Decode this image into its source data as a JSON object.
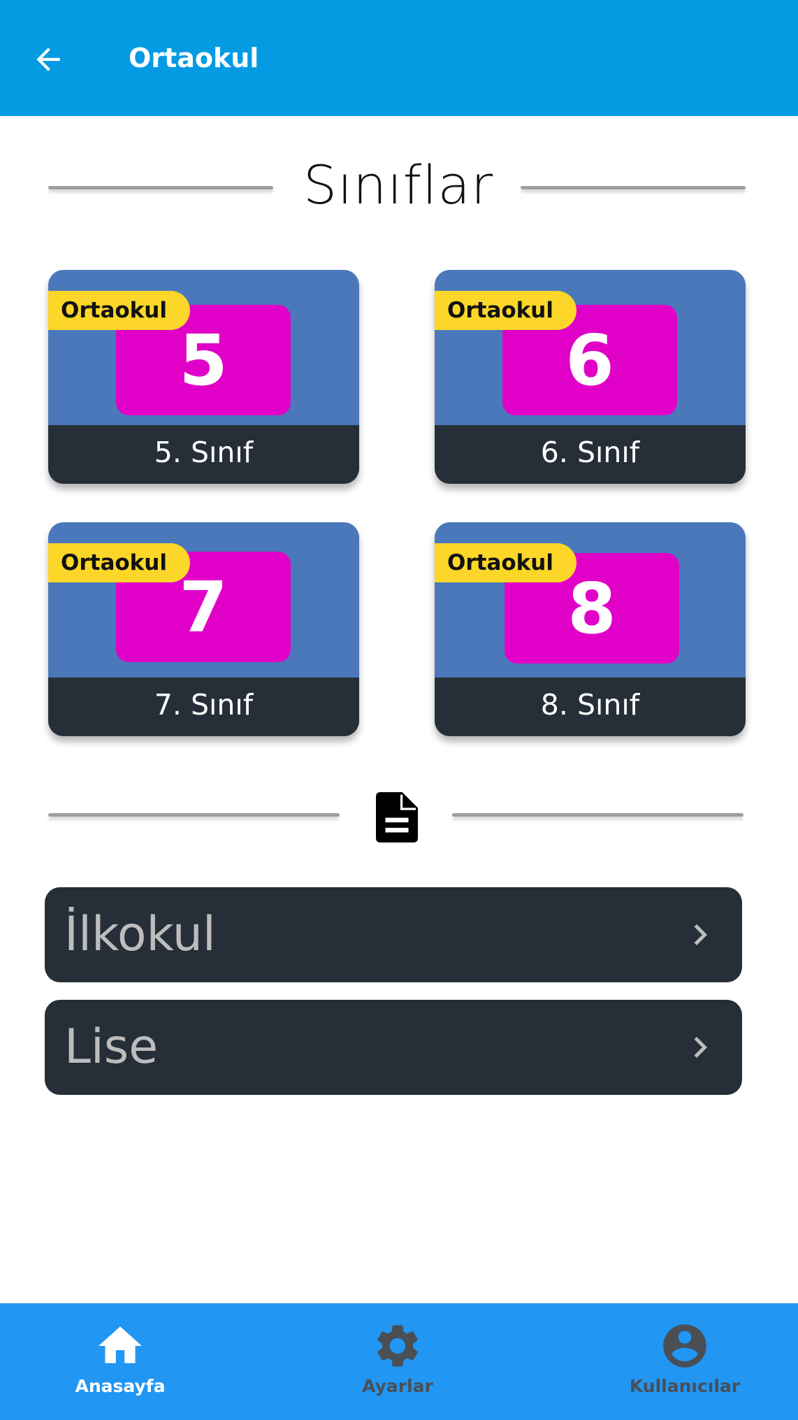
{
  "appbar": {
    "title": "Ortaokul",
    "back_icon": "arrow-left-icon"
  },
  "section": {
    "title": "Sınıflar"
  },
  "grades": [
    {
      "number": "5",
      "badge": "Ortaokul",
      "label": "5. Sınıf"
    },
    {
      "number": "6",
      "badge": "Ortaokul",
      "label": "6. Sınıf"
    },
    {
      "number": "7",
      "badge": "Ortaokul",
      "label": "7. Sınıf"
    },
    {
      "number": "8",
      "badge": "Ortaokul",
      "label": "8. Sınıf"
    }
  ],
  "divider_icon": "document-icon",
  "levels": [
    {
      "label": "İlkokul",
      "icon": "chevron-right-icon"
    },
    {
      "label": "Lise",
      "icon": "chevron-right-icon"
    }
  ],
  "bottom_nav": {
    "items": [
      {
        "label": "Anasayfa",
        "icon": "home-icon",
        "active": true
      },
      {
        "label": "Ayarlar",
        "icon": "gear-icon",
        "active": false
      },
      {
        "label": "Kullanıcılar",
        "icon": "account-circle-icon",
        "active": false
      }
    ]
  },
  "colors": {
    "appbar": "#049be3",
    "bottom_nav": "#2196f3",
    "card_top": "#4b78bb",
    "card_footer": "#262f38",
    "thumb": "#e100c8",
    "badge": "#fcd628",
    "level_row": "#262f38"
  }
}
